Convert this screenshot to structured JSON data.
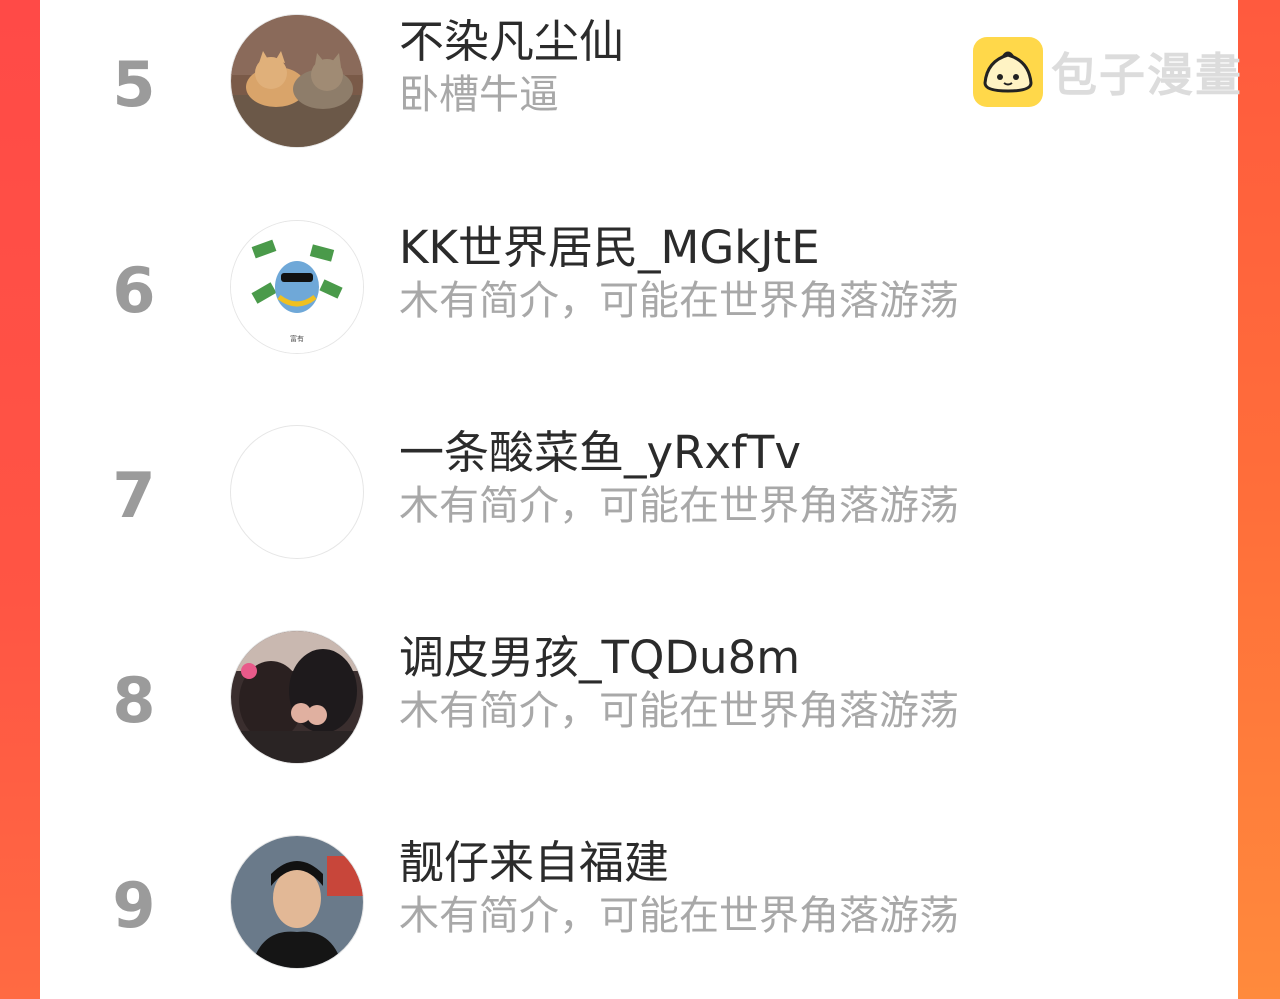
{
  "watermark": {
    "text": "包子漫畫",
    "logo_icon": "bun-logo-icon"
  },
  "colors": {
    "side_left": "#ff4a47",
    "side_right": "#ff7a3a",
    "rank": "#9b9b9b",
    "name": "#2b2b2b",
    "bio": "#a8a8a8"
  },
  "ranking": [
    {
      "rank": "5",
      "name": "不染凡尘仙",
      "bio": "卧槽牛逼",
      "avatar": "cats-photo-avatar"
    },
    {
      "rank": "6",
      "name": "KK世界居民_MGkJtE",
      "bio": "木有简介，可能在世界角落游荡",
      "avatar": "cartoon-sticker-avatar"
    },
    {
      "rank": "7",
      "name": "一条酸菜鱼_yRxfTv",
      "bio": "木有简介，可能在世界角落游荡",
      "avatar": "blank-avatar"
    },
    {
      "rank": "8",
      "name": "调皮男孩_TQDu8m",
      "bio": "木有简介，可能在世界角落游荡",
      "avatar": "couple-photo-avatar"
    },
    {
      "rank": "9",
      "name": "靓仔来自福建",
      "bio": "木有简介，可能在世界角落游荡",
      "avatar": "man-portrait-avatar"
    }
  ]
}
